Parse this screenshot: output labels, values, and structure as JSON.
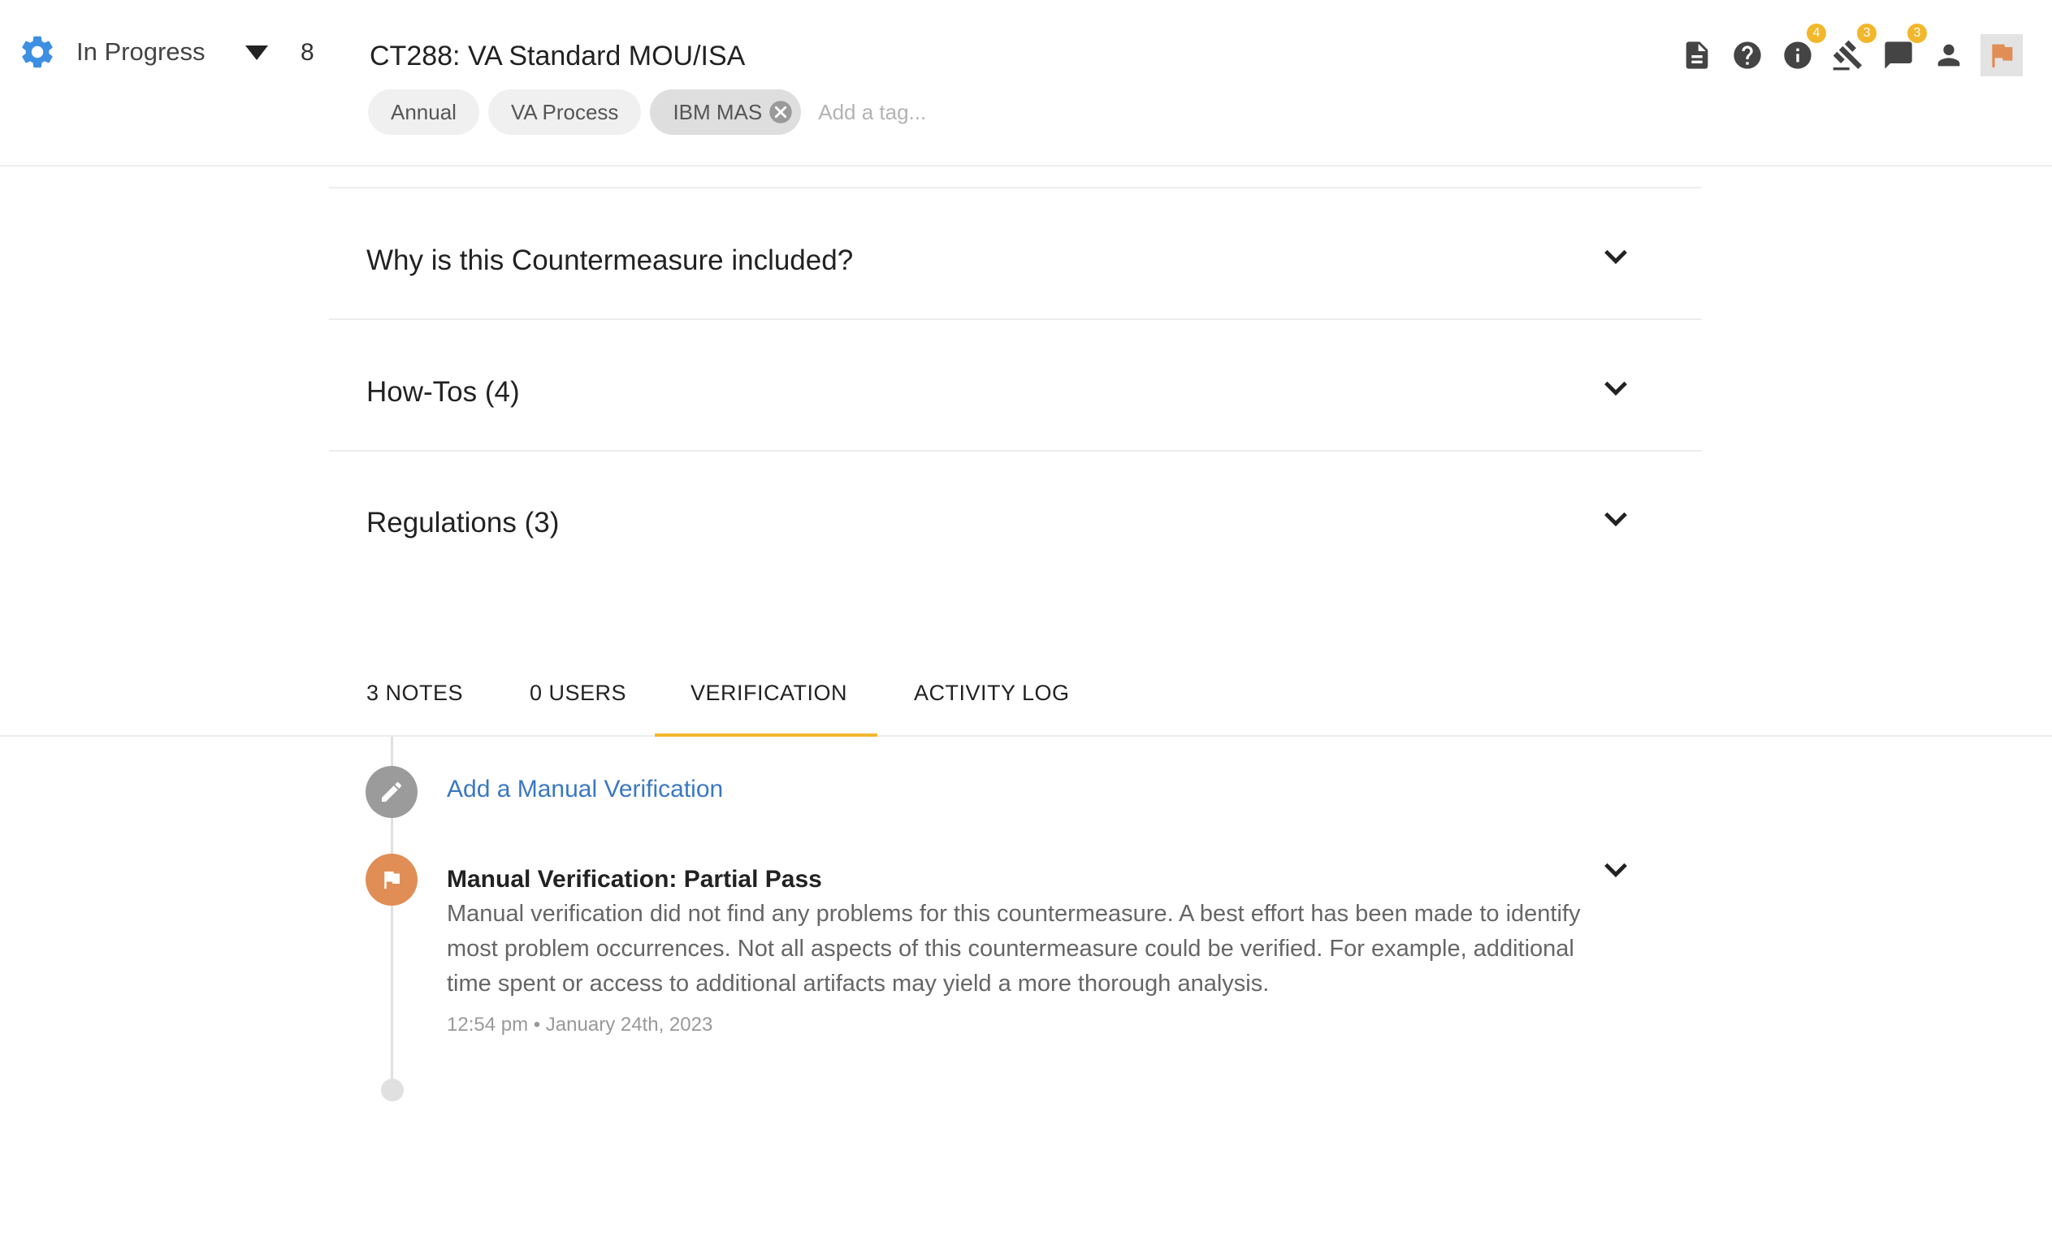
{
  "header": {
    "status": "In Progress",
    "count": "8",
    "title": "CT288: VA Standard MOU/ISA",
    "tags": [
      "Annual",
      "VA Process",
      "IBM MAS"
    ],
    "add_tag_placeholder": "Add a tag...",
    "toolbar": {
      "info_badge": "4",
      "gavel_badge": "3",
      "chat_badge": "3"
    }
  },
  "sections": [
    {
      "title": "Why is this Countermeasure included?"
    },
    {
      "title": "How-Tos (4)"
    },
    {
      "title": "Regulations (3)"
    }
  ],
  "tabs": [
    "3 NOTES",
    "0 USERS",
    "VERIFICATION",
    "ACTIVITY LOG"
  ],
  "active_tab": "VERIFICATION",
  "verification": {
    "add_label": "Add a Manual Verification",
    "entry": {
      "title": "Manual Verification: Partial Pass",
      "description": "Manual verification did not find any problems for this countermeasure. A best effort has been made to identify most problem occurrences. Not all aspects of this countermeasure could be verified. For example, additional time spent or access to additional artifacts may yield a more thorough analysis.",
      "timestamp": "12:54 pm • January 24th, 2023"
    }
  },
  "colors": {
    "accent": "#f2b72b",
    "link": "#3a78c2",
    "gear": "#3d8fe0",
    "flag": "#e08e55"
  }
}
